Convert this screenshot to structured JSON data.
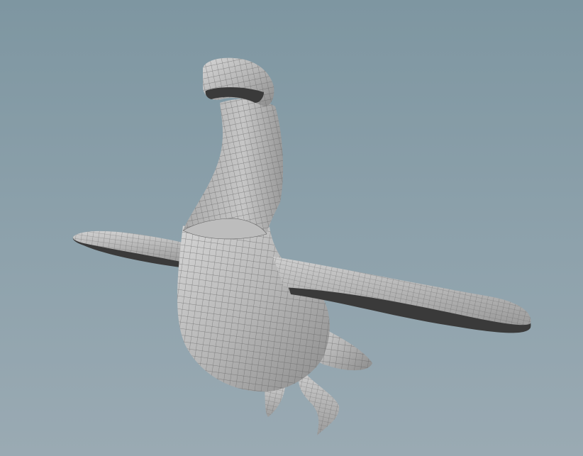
{
  "viewport": {
    "background_top": "#7e96a1",
    "background_bottom": "#9aaab3",
    "shading": "smooth-shaded-wireframe",
    "object": "plesiosaur-sculpt-mesh"
  },
  "colors": {
    "mesh_surface": "#b9b9b9",
    "mesh_shadow": "#3a3a3a",
    "wire": "#5f5f5f",
    "inner_cut": "#a9a9a9"
  }
}
